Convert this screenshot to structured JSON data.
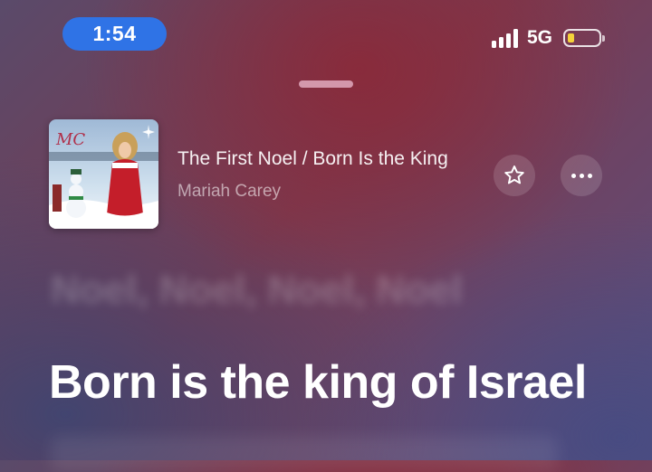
{
  "status_bar": {
    "time": "1:54",
    "network": "5G",
    "signal_bars": 4,
    "battery_level": 0.15,
    "time_pill_color": "#2f73e6",
    "battery_color": "#f5d23a"
  },
  "now_playing": {
    "album_art": "mariah-carey-merry-christmas-ii-you-cover",
    "title": "The First Noel / Born Is the King",
    "artist": "Mariah Carey",
    "favorite_icon": "star-outline-icon",
    "more_icon": "ellipsis-icon"
  },
  "lyrics": {
    "previous_line": "Noel, Noel, Noel, Noel",
    "current_line": "Born is the king of Israel"
  }
}
